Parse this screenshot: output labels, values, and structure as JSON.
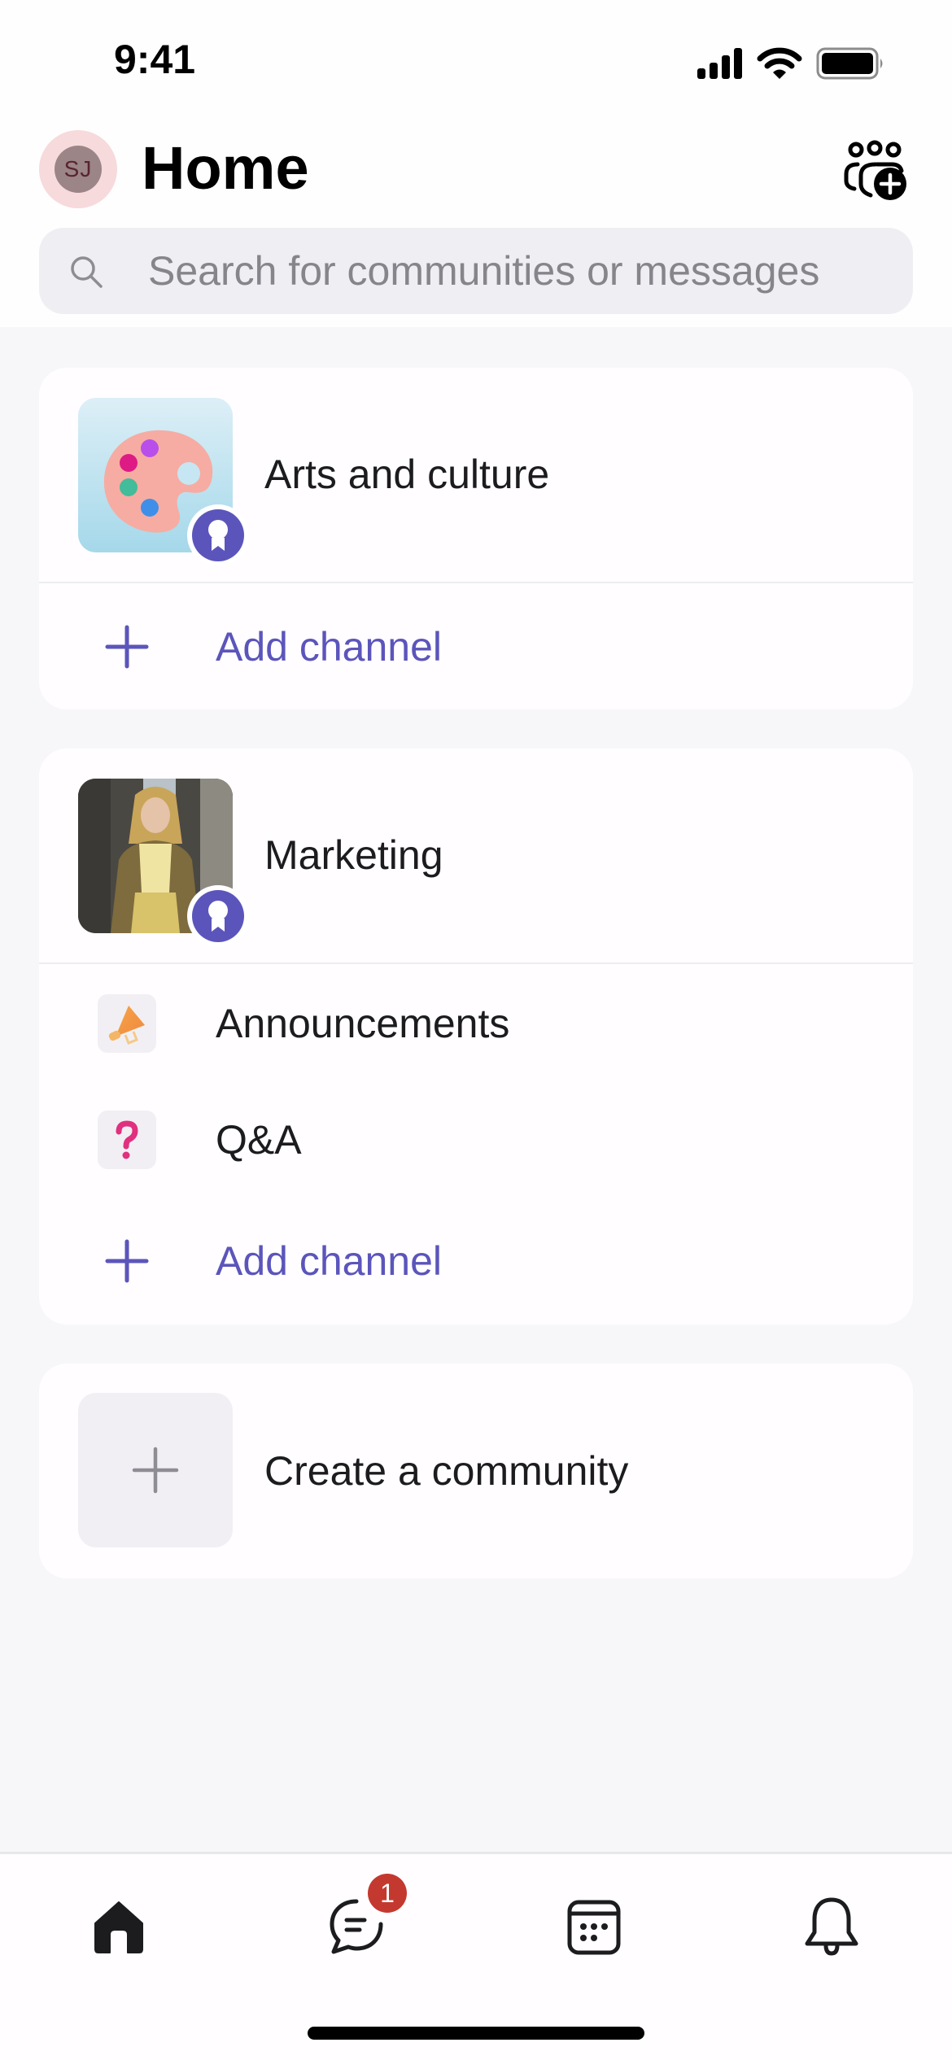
{
  "status_bar": {
    "time": "9:41"
  },
  "header": {
    "avatar_initials": "SJ",
    "title": "Home",
    "group_add_icon": "people-add-icon"
  },
  "search": {
    "placeholder": "Search for communities or messages",
    "value": ""
  },
  "communities": [
    {
      "name": "Arts and culture",
      "thumbnail": "palette-image",
      "badge_icon": "ribbon-award-icon",
      "channels": [],
      "add_channel_label": "Add channel"
    },
    {
      "name": "Marketing",
      "thumbnail": "photo-woman-plaid-jacket",
      "badge_icon": "ribbon-award-icon",
      "channels": [
        {
          "name": "Announcements",
          "icon": "megaphone-icon"
        },
        {
          "name": "Q&A",
          "icon": "question-mark-icon"
        }
      ],
      "add_channel_label": "Add channel"
    }
  ],
  "create_community": {
    "label": "Create a community",
    "icon": "plus-icon"
  },
  "bottom_nav": {
    "items": [
      {
        "name": "home",
        "icon": "home-icon",
        "active": true
      },
      {
        "name": "chat",
        "icon": "chat-icon",
        "badge": "1"
      },
      {
        "name": "calendar",
        "icon": "calendar-icon"
      },
      {
        "name": "activity",
        "icon": "bell-icon"
      }
    ]
  },
  "colors": {
    "accent": "#5B55BB",
    "background": "#F7F6F9",
    "card": "#FFFDFF",
    "badge_red": "#C4392F",
    "avatar_ring": "#F7DADC"
  }
}
